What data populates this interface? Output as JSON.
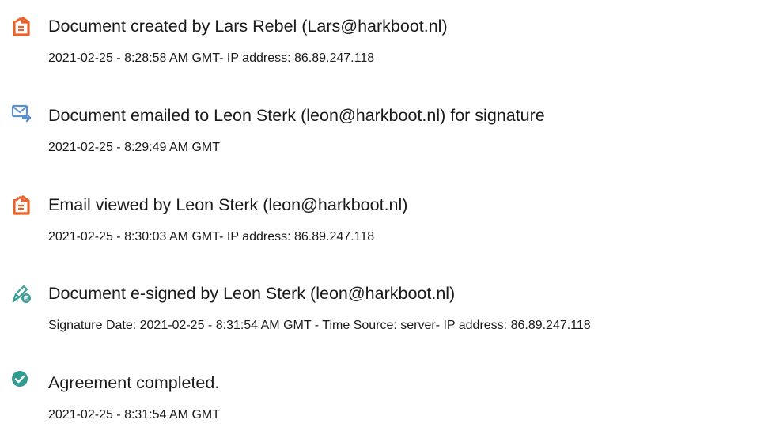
{
  "events": [
    {
      "icon": "document-created-icon",
      "title": "Document created by Lars Rebel (Lars@harkboot.nl)",
      "detail": "2021-02-25 - 8:28:58 AM GMT- IP address: 86.89.247.118"
    },
    {
      "icon": "email-sent-icon",
      "title": "Document emailed to Leon Sterk (leon@harkboot.nl) for signature",
      "detail": "2021-02-25 - 8:29:49 AM GMT"
    },
    {
      "icon": "document-viewed-icon",
      "title": "Email viewed by Leon Sterk (leon@harkboot.nl)",
      "detail": "2021-02-25 - 8:30:03 AM GMT- IP address: 86.89.247.118"
    },
    {
      "icon": "e-signature-icon",
      "title": "Document e-signed by Leon Sterk (leon@harkboot.nl)",
      "detail": "Signature Date: 2021-02-25 - 8:31:54 AM GMT - Time Source: server- IP address: 86.89.247.118"
    },
    {
      "icon": "checkmark-circle-icon",
      "title": "Agreement completed.",
      "detail": "2021-02-25 - 8:31:54 AM GMT"
    }
  ],
  "colors": {
    "document_icon": "#e8622c",
    "email_icon": "#5b8fd4",
    "signature_icon": "#3f9e97",
    "complete_icon": "#2e9c8f",
    "text": "#1a1a1a"
  }
}
